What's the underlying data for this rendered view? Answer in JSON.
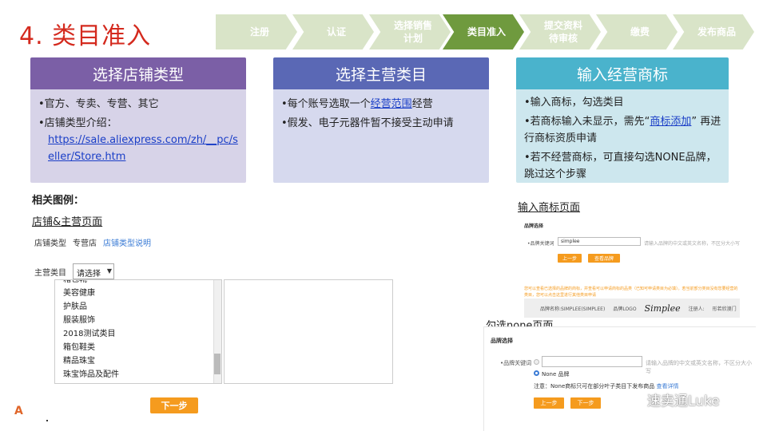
{
  "title": "4. 类目准入",
  "steps": [
    {
      "label": "注册",
      "active": false
    },
    {
      "label": "认证",
      "active": false
    },
    {
      "label": "选择销售计划",
      "active": false
    },
    {
      "label": "类目准入",
      "active": true
    },
    {
      "label": "提交资料待审核",
      "active": false
    },
    {
      "label": "缴费",
      "active": false
    },
    {
      "label": "发布商品",
      "active": false
    }
  ],
  "cards": [
    {
      "title": "选择店铺类型",
      "line1": "•官方、专卖、专营、其它",
      "line2": "•店铺类型介绍：",
      "url": "https://sale.aliexpress.com/zh/__pc/seller/Store.htm"
    },
    {
      "title": "选择主营类目",
      "line1_pre": "•每个账号选取一个",
      "line1_link": "经营范围",
      "line1_post": "经营",
      "line2": "•假发、电子元器件暂不接受主动申请"
    },
    {
      "title": "输入经营商标",
      "line1": "•输入商标，勾选类目",
      "line2_pre": "•若商标输入未显示，需先“",
      "line2_link": "商标添加",
      "line2_post": "” 再进行商标资质申请",
      "line3": "•若不经营商标，可直接勾选NONE品牌，跳过这个步骤"
    }
  ],
  "related_label": "相关图例：",
  "store_section": {
    "heading": "店铺&主营页面",
    "store_type_label": "店铺类型",
    "store_type_value": "专营店",
    "store_type_link": "店铺类型说明",
    "main_category_label": "主营类目",
    "select_value": "请选择",
    "categories": [
      "箱包靴",
      "美容健康",
      "护肤品",
      "服装服饰",
      "2018测试类目",
      "箱包鞋类",
      "精品珠宝",
      "珠宝饰品及配件"
    ],
    "next_button": "下一步",
    "logo_letter": "A"
  },
  "brand_section": {
    "heading": "输入商标页面",
    "panel_title": "品牌选择",
    "field_label": "•品牌关键词",
    "field_value": "simplee",
    "field_hint": "请输入品牌的中文或英文名称，不区分大小写",
    "prev_button": "上一步",
    "query_button": "查看品牌",
    "warning": "您可以查看已选择的品牌的商标，并查看可以申请商标的品类（已知可申请类目为必填）。若当前部分类目没有您要经营的类目，您可以点击这里进行其他类目申请",
    "brand_name": "品牌名称:SIMPLEE(SIMPLEE)",
    "brand_logo_label": "品牌LOGO",
    "brand_logo": "Simplee",
    "registrant": "注册人:",
    "registrant_value": "形若欣澳门"
  },
  "none_section": {
    "heading": "勾选none页面",
    "panel_title": "品牌选择",
    "field_label": "•品牌关键词",
    "field_hint": "请输入品牌的中文或英文名称，不区分大小写",
    "none_label": "None 品牌",
    "note_pre": "注意：None商标只可在部分叶子类目下发布商品",
    "note_link": "查看详情",
    "prev_button": "上一步",
    "next_button": "下一步"
  },
  "watermark": "速卖通Luke"
}
